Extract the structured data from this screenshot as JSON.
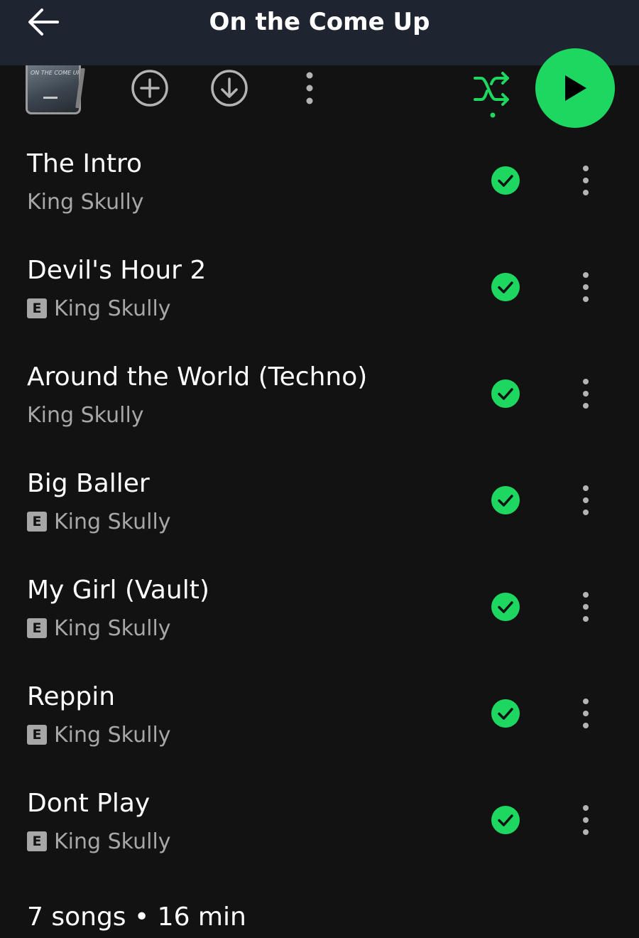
{
  "header": {
    "title": "On the Come Up",
    "back_icon": "arrow-left-icon"
  },
  "toolbar": {
    "album_art_text": "ON THE COME UP",
    "add_icon": "plus-circle-icon",
    "download_icon": "download-circle-icon",
    "more_icon": "vertical-dots-icon",
    "shuffle_icon": "shuffle-icon",
    "play_icon": "play-icon"
  },
  "colors": {
    "accent": "#1ed760",
    "background": "#121212",
    "header_background": "#1f2530",
    "secondary_text": "#a7a7a7"
  },
  "tracks": [
    {
      "title": "The Intro",
      "artist": "King Skully",
      "explicit": false,
      "downloaded": true
    },
    {
      "title": "Devil's Hour 2",
      "artist": "King Skully",
      "explicit": true,
      "downloaded": true
    },
    {
      "title": "Around the World (Techno)",
      "artist": "King Skully",
      "explicit": false,
      "downloaded": true
    },
    {
      "title": "Big Baller",
      "artist": "King Skully",
      "explicit": true,
      "downloaded": true
    },
    {
      "title": "My Girl (Vault)",
      "artist": "King Skully",
      "explicit": true,
      "downloaded": true
    },
    {
      "title": "Reppin",
      "artist": "King Skully",
      "explicit": true,
      "downloaded": true
    },
    {
      "title": "Dont Play",
      "artist": "King Skully",
      "explicit": true,
      "downloaded": true
    }
  ],
  "explicit_label": "E",
  "summary": "7 songs • 16 min"
}
